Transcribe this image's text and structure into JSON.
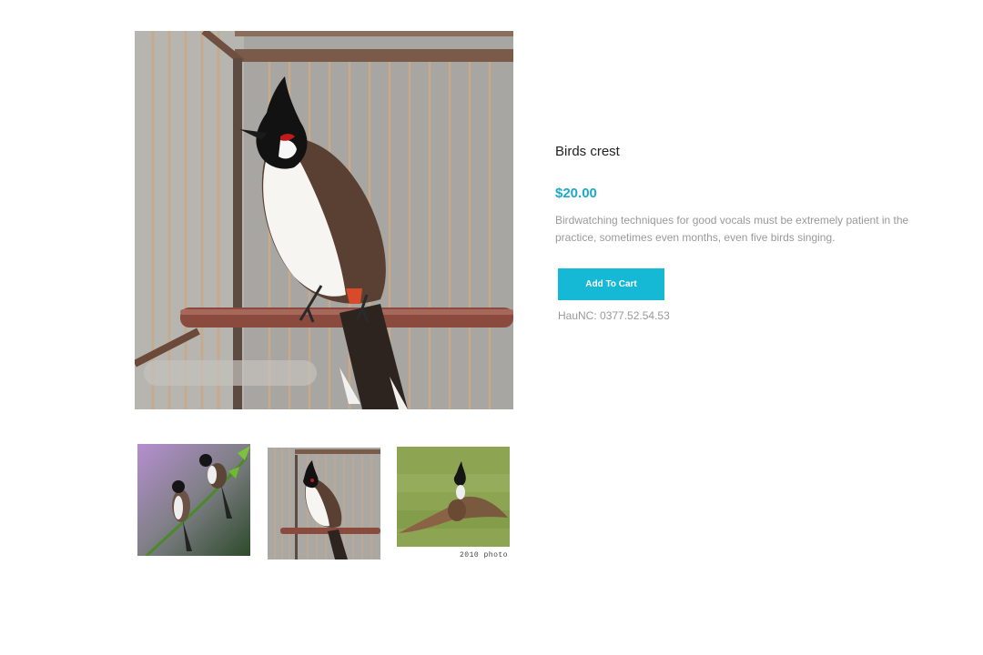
{
  "product": {
    "title": "Birds crest",
    "price": "$20.00",
    "description": "Birdwatching techniques for good vocals must be extremely patient in the practice, sometimes even months, even five birds singing.",
    "add_to_cart_label": "Add To Cart",
    "contact": "HauNC: 0377.52.54.53"
  },
  "gallery": {
    "thumb3_caption": "2010 photo"
  },
  "colors": {
    "accent": "#15b9d5",
    "price": "#1ea9c7"
  }
}
